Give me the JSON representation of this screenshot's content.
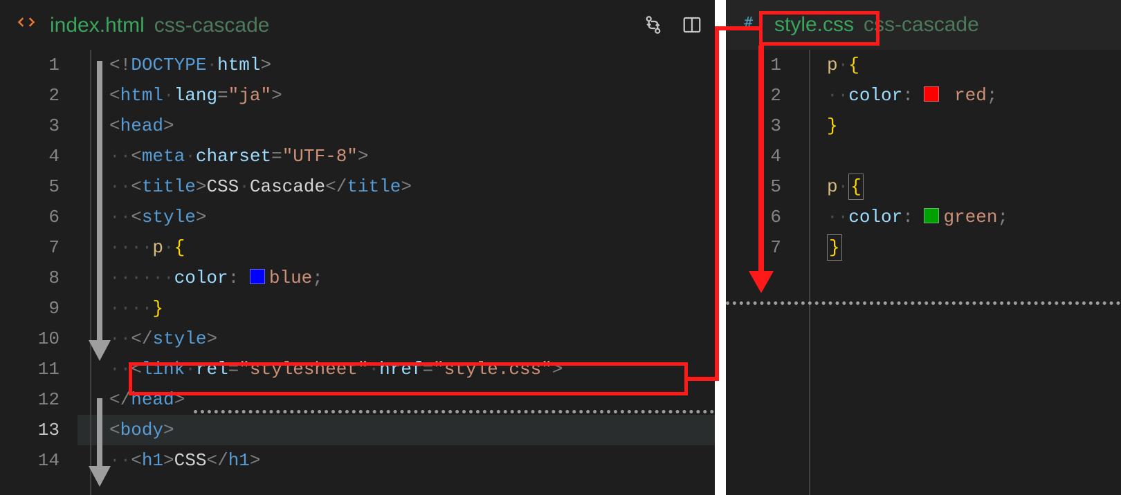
{
  "left": {
    "tab": {
      "file": "index.html",
      "folder": "css-cascade"
    },
    "lines": [
      {
        "n": 1,
        "tokens": [
          [
            "punct",
            "<!"
          ],
          [
            "doctype",
            "DOCTYPE"
          ],
          [
            "ws",
            "·"
          ],
          [
            "attr",
            "html"
          ],
          [
            "punct",
            ">"
          ]
        ]
      },
      {
        "n": 2,
        "tokens": [
          [
            "punct",
            "<"
          ],
          [
            "tagname",
            "html"
          ],
          [
            "ws",
            "·"
          ],
          [
            "attr",
            "lang"
          ],
          [
            "punct",
            "="
          ],
          [
            "string",
            "\"ja\""
          ],
          [
            "punct",
            ">"
          ]
        ]
      },
      {
        "n": 3,
        "tokens": [
          [
            "punct",
            "<"
          ],
          [
            "tagname",
            "head"
          ],
          [
            "punct",
            ">"
          ]
        ]
      },
      {
        "n": 4,
        "tokens": [
          [
            "ws",
            "··"
          ],
          [
            "punct",
            "<"
          ],
          [
            "tagname",
            "meta"
          ],
          [
            "ws",
            "·"
          ],
          [
            "attr",
            "charset"
          ],
          [
            "punct",
            "="
          ],
          [
            "string",
            "\"UTF-8\""
          ],
          [
            "punct",
            ">"
          ]
        ]
      },
      {
        "n": 5,
        "tokens": [
          [
            "ws",
            "··"
          ],
          [
            "punct",
            "<"
          ],
          [
            "tagname",
            "title"
          ],
          [
            "punct",
            ">"
          ],
          [
            "text",
            "CSS"
          ],
          [
            "ws",
            "·"
          ],
          [
            "text",
            "Cascade"
          ],
          [
            "punct",
            "</"
          ],
          [
            "tagname",
            "title"
          ],
          [
            "punct",
            ">"
          ]
        ]
      },
      {
        "n": 6,
        "tokens": [
          [
            "ws",
            "··"
          ],
          [
            "punct",
            "<"
          ],
          [
            "tagname",
            "style"
          ],
          [
            "punct",
            ">"
          ]
        ]
      },
      {
        "n": 7,
        "tokens": [
          [
            "ws",
            "····"
          ],
          [
            "selector",
            "p"
          ],
          [
            "ws",
            "·"
          ],
          [
            "brace",
            "{"
          ]
        ]
      },
      {
        "n": 8,
        "tokens": [
          [
            "ws",
            "······"
          ],
          [
            "prop",
            "color"
          ],
          [
            "punct",
            ":"
          ],
          [
            "ws",
            " "
          ],
          [
            "swatch",
            "#0000ff"
          ],
          [
            "value",
            "blue"
          ],
          [
            "punct",
            ";"
          ]
        ]
      },
      {
        "n": 9,
        "tokens": [
          [
            "ws",
            "····"
          ],
          [
            "brace",
            "}"
          ]
        ]
      },
      {
        "n": 10,
        "tokens": [
          [
            "ws",
            "··"
          ],
          [
            "punct",
            "</"
          ],
          [
            "tagname",
            "style"
          ],
          [
            "punct",
            ">"
          ]
        ]
      },
      {
        "n": 11,
        "tokens": [
          [
            "ws",
            "··"
          ],
          [
            "punct",
            "<"
          ],
          [
            "tagname",
            "link"
          ],
          [
            "ws",
            "·"
          ],
          [
            "attr",
            "rel"
          ],
          [
            "punct",
            "="
          ],
          [
            "string",
            "\"stylesheet\""
          ],
          [
            "ws",
            "·"
          ],
          [
            "attr",
            "href"
          ],
          [
            "punct",
            "="
          ],
          [
            "string",
            "\"style.css\""
          ],
          [
            "punct",
            ">"
          ]
        ]
      },
      {
        "n": 12,
        "tokens": [
          [
            "punct",
            "</"
          ],
          [
            "tagname",
            "head"
          ],
          [
            "punct",
            ">"
          ]
        ]
      },
      {
        "n": 13,
        "current": true,
        "tokens": [
          [
            "punct",
            "<"
          ],
          [
            "tagname",
            "body"
          ],
          [
            "punct",
            ">"
          ]
        ]
      },
      {
        "n": 14,
        "tokens": [
          [
            "ws",
            "··"
          ],
          [
            "punct",
            "<"
          ],
          [
            "tagname",
            "h1"
          ],
          [
            "punct",
            ">"
          ],
          [
            "text",
            "CSS"
          ],
          [
            "punct",
            "</"
          ],
          [
            "tagname",
            "h1"
          ],
          [
            "punct",
            ">"
          ]
        ]
      }
    ]
  },
  "right": {
    "tab": {
      "file": "style.css",
      "folder": "css-cascade"
    },
    "lines": [
      {
        "n": 1,
        "tokens": [
          [
            "selector",
            "p"
          ],
          [
            "ws",
            "·"
          ],
          [
            "brace",
            "{"
          ]
        ]
      },
      {
        "n": 2,
        "tokens": [
          [
            "ws",
            "··"
          ],
          [
            "prop",
            "color"
          ],
          [
            "punct",
            ":"
          ],
          [
            "ws",
            " "
          ],
          [
            "swatch",
            "#ff0000"
          ],
          [
            "ws",
            " "
          ],
          [
            "value",
            "red"
          ],
          [
            "punct",
            ";"
          ]
        ]
      },
      {
        "n": 3,
        "tokens": [
          [
            "brace",
            "}"
          ]
        ]
      },
      {
        "n": 4,
        "tokens": []
      },
      {
        "n": 5,
        "tokens": [
          [
            "selector",
            "p"
          ],
          [
            "ws",
            "·"
          ],
          [
            "brace-hint",
            "{"
          ]
        ]
      },
      {
        "n": 6,
        "tokens": [
          [
            "ws",
            "··"
          ],
          [
            "prop",
            "color"
          ],
          [
            "punct",
            ":"
          ],
          [
            "ws",
            " "
          ],
          [
            "swatch",
            "#00a000"
          ],
          [
            "value",
            "green"
          ],
          [
            "punct",
            ";"
          ]
        ]
      },
      {
        "n": 7,
        "tokens": [
          [
            "brace-hint",
            "}"
          ]
        ]
      }
    ]
  },
  "colors": {
    "annotation_red": "#ff1a1a",
    "annotation_grey": "#9e9e9e"
  }
}
